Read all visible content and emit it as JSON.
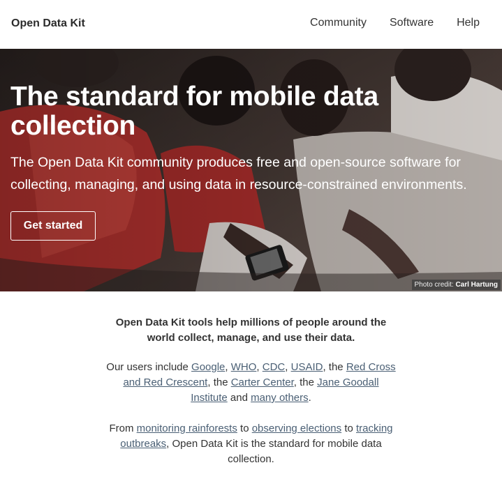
{
  "navbar": {
    "brand": "Open Data Kit",
    "links": [
      "Community",
      "Software",
      "Help"
    ]
  },
  "hero": {
    "title": "The standard for mobile data collection",
    "subtitle": "The Open Data Kit community produces free and open-source software for collecting, managing, and using data in resource-constrained environments.",
    "cta_label": "Get started",
    "credit_prefix": "Photo credit:",
    "credit_name": "Carl Hartung"
  },
  "content": {
    "lead": "Open Data Kit tools help millions of people around the world collect, manage, and use their data.",
    "users": {
      "prefix": "Our users include",
      "google": "Google",
      "who": "WHO",
      "cdc": "CDC",
      "usaid": "USAID",
      "the1": "the",
      "red_cross": "Red Cross and Red Crescent",
      "the2": "the",
      "carter": "Carter Center",
      "the3": "the",
      "jane": "Jane Goodall Institute",
      "and": "and",
      "many": "many others"
    },
    "mission": {
      "from": "From",
      "rainforests": "monitoring rainforests",
      "to1": "to",
      "elections": "observing elections",
      "to2": "to",
      "outbreaks": "tracking outbreaks",
      "suffix": ", Open Data Kit is the standard for mobile data collection."
    }
  },
  "colors": {
    "link": "#4a5f74",
    "hero_text": "#ffffff",
    "brand_text": "#2b2b2b"
  }
}
